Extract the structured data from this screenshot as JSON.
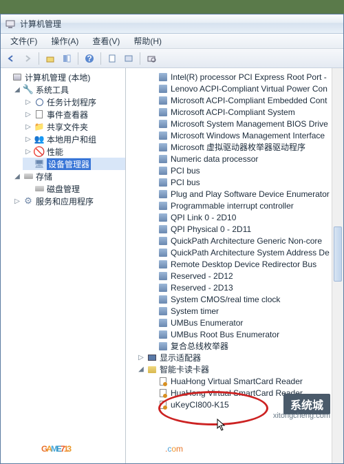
{
  "window": {
    "title": "计算机管理"
  },
  "menu": {
    "file": "文件(F)",
    "action": "操作(A)",
    "view": "查看(V)",
    "help": "帮助(H)"
  },
  "left": {
    "root": "计算机管理 (本地)",
    "systools": "系统工具",
    "sched": "任务计划程序",
    "event": "事件查看器",
    "share": "共享文件夹",
    "users": "本地用户和组",
    "perf": "性能",
    "devmgr": "设备管理器",
    "storage": "存储",
    "diskmgr": "磁盘管理",
    "services": "服务和应用程序"
  },
  "devices": [
    "Intel(R) processor PCI Express Root Port -",
    "Lenovo ACPI-Compliant Virtual Power Con",
    "Microsoft ACPI-Compliant Embedded Cont",
    "Microsoft ACPI-Compliant System",
    "Microsoft System Management BIOS Drive",
    "Microsoft Windows Management Interface",
    "Microsoft 虚拟驱动器枚举器驱动程序",
    "Numeric data processor",
    "PCI bus",
    "PCI bus",
    "Plug and Play Software Device Enumerator",
    "Programmable interrupt controller",
    "QPI Link 0 - 2D10",
    "QPI Physical 0 - 2D11",
    "QuickPath Architecture Generic Non-core ",
    "QuickPath Architecture System Address De",
    "Remote Desktop Device Redirector Bus",
    "Reserved - 2D12",
    "Reserved - 2D13",
    "System CMOS/real time clock",
    "System timer",
    "UMBus Enumerator",
    "UMBus Root Bus Enumerator",
    "复合总线枚举器"
  ],
  "categories": {
    "display": "显示适配器",
    "smartcard": "智能卡读卡器"
  },
  "smartcard_items": [
    "HuaHong Virtual SmartCard Reader",
    "HuaHong Virtual SmartCard Reader",
    "uKeyCI800-K15"
  ],
  "watermark": {
    "main": "GAME713",
    "sub": ".com",
    "box": "系统城",
    "url": "xitongcheng.com"
  }
}
